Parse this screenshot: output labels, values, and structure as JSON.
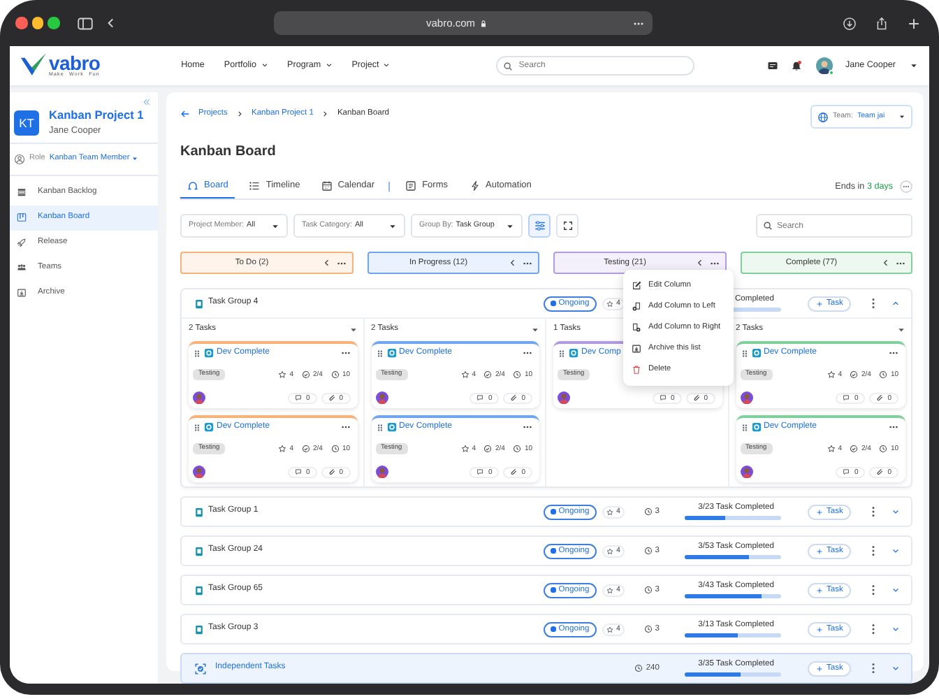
{
  "browser": {
    "url": "vabro.com"
  },
  "navbar": {
    "logo": "vabro",
    "tagline": "Make Work Fun",
    "menu": [
      {
        "label": "Home",
        "dropdown": false
      },
      {
        "label": "Portfolio",
        "dropdown": true
      },
      {
        "label": "Program",
        "dropdown": true
      },
      {
        "label": "Project",
        "dropdown": true
      }
    ],
    "search": {
      "placeholder": "Search"
    },
    "notification": true,
    "user": {
      "name": "Jane Cooper",
      "online": true
    }
  },
  "sidebar": {
    "project": {
      "initials": "KT",
      "name": "Kanban Project 1",
      "owner": "Jane Cooper"
    },
    "role": {
      "label": "Role",
      "value": "Kanban Team Member"
    },
    "items": [
      {
        "label": "Kanban Backlog",
        "selected": false
      },
      {
        "label": "Kanban Board",
        "selected": true
      },
      {
        "label": "Release",
        "selected": false
      },
      {
        "label": "Teams",
        "selected": false
      },
      {
        "label": "Archive",
        "selected": false
      }
    ]
  },
  "breadcrumb": [
    {
      "label": "Projects",
      "current": false
    },
    {
      "label": "Kanban Project 1",
      "current": false
    },
    {
      "label": "Kanban Board",
      "current": true
    }
  ],
  "team": {
    "label": "Team:",
    "value": "Team jai"
  },
  "title": "Kanban Board",
  "tabs": [
    {
      "label": "Board",
      "selected": true,
      "separated": false
    },
    {
      "label": "Timeline",
      "selected": false,
      "separated": false
    },
    {
      "label": "Calendar",
      "selected": false,
      "separated": false
    },
    {
      "label": "Forms",
      "selected": false,
      "separated": true
    },
    {
      "label": "Automation",
      "selected": false,
      "separated": false
    }
  ],
  "deadline": {
    "prefix": "Ends in",
    "value": "3 days"
  },
  "filters": [
    {
      "label": "Project Member:",
      "value": "All"
    },
    {
      "label": "Task Category:",
      "value": "All"
    },
    {
      "label": "Group By:",
      "value": "Task Group"
    }
  ],
  "board_search": {
    "placeholder": "Search"
  },
  "columns": [
    {
      "name": "To Do (2)",
      "color": "#f7b27a"
    },
    {
      "name": "In Progress (12)",
      "color": "#6fa6ef"
    },
    {
      "name": "Testing (21)",
      "color": "#b39be3"
    },
    {
      "name": "Complete (77)",
      "color": "#7fd09d"
    }
  ],
  "task_groups": [
    {
      "kind": "group",
      "name": "Task Group 4",
      "status": "Ongoing",
      "points": "4",
      "progress_text": "Completed",
      "add_label": "Task",
      "expanded": true,
      "lanes": [
        {
          "count": "2 Tasks",
          "cards": [
            {
              "title": "Dev Complete",
              "tag": "Testing",
              "points": "4",
              "checklist": "2/4",
              "time": "10",
              "comments": "0",
              "attachments": "0"
            },
            {
              "title": "Dev Complete",
              "tag": "Testing",
              "points": "4",
              "checklist": "2/4",
              "time": "10",
              "comments": "0",
              "attachments": "0"
            }
          ]
        },
        {
          "count": "2 Tasks",
          "cards": [
            {
              "title": "Dev Complete",
              "tag": "Testing",
              "points": "4",
              "checklist": "2/4",
              "time": "10",
              "comments": "0",
              "attachments": "0"
            },
            {
              "title": "Dev Complete",
              "tag": "Testing",
              "points": "4",
              "checklist": "2/4",
              "time": "10",
              "comments": "0",
              "attachments": "0"
            }
          ]
        },
        {
          "count": "1 Tasks",
          "caret": false,
          "cards": [
            {
              "title": "Dev Comp",
              "tag": "Testing",
              "comments": "0",
              "attachments": "0"
            }
          ]
        },
        {
          "count": "2 Tasks",
          "cards": [
            {
              "title": "Dev Complete",
              "tag": "Testing",
              "points": "4",
              "checklist": "2/4",
              "time": "10",
              "comments": "0",
              "attachments": "0"
            },
            {
              "title": "Dev Complete",
              "tag": "Testing",
              "points": "4",
              "checklist": "2/4",
              "time": "10",
              "comments": "0",
              "attachments": "0"
            }
          ]
        }
      ]
    },
    {
      "kind": "group",
      "name": "Task Group 1",
      "status": "Ongoing",
      "points": "4",
      "time": "3",
      "progress_text": "3/23 Task Completed",
      "level": 0.42,
      "add_label": "Task",
      "expanded": false
    },
    {
      "kind": "group",
      "name": "Task Group 24",
      "status": "Ongoing",
      "points": "4",
      "time": "3",
      "progress_text": "3/53 Task Completed",
      "level": 0.66,
      "add_label": "Task",
      "expanded": false
    },
    {
      "kind": "group",
      "name": "Task Group 65",
      "status": "Ongoing",
      "points": "4",
      "time": "3",
      "progress_text": "3/43 Task Completed",
      "level": 0.8,
      "add_label": "Task",
      "expanded": false
    },
    {
      "kind": "group",
      "name": "Task Group 3",
      "status": "Ongoing",
      "points": "4",
      "time": "3",
      "progress_text": "3/13 Task Completed",
      "level": 0.55,
      "add_label": "Task",
      "expanded": false
    },
    {
      "kind": "independent",
      "name": "Independent Tasks",
      "time": "240",
      "progress_text": "3/35 Task Completed",
      "level": 0.58,
      "add_label": "Task",
      "expanded": false
    }
  ],
  "column_menu": {
    "items": [
      {
        "label": "Edit Column",
        "kind": "edit"
      },
      {
        "label": "Add Column to Left",
        "kind": "add-left"
      },
      {
        "label": "Add Column to Right",
        "kind": "add-right"
      },
      {
        "label": "Archive this list",
        "kind": "archive"
      },
      {
        "label": "Delete",
        "kind": "delete"
      }
    ]
  }
}
